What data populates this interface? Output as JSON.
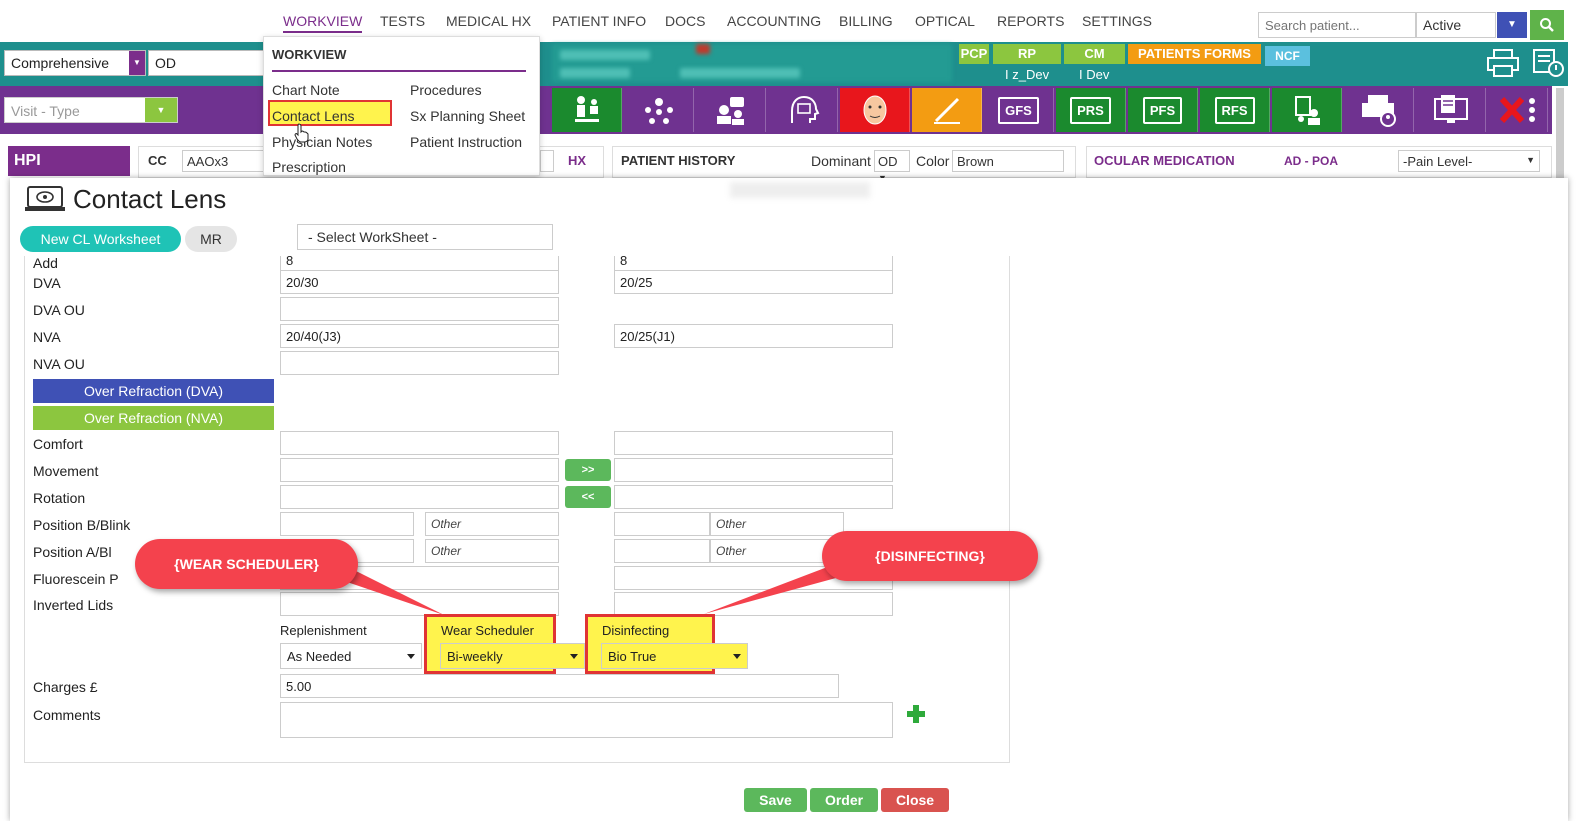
{
  "nav": {
    "items": [
      "WORKVIEW",
      "TESTS",
      "MEDICAL HX",
      "PATIENT INFO",
      "DOCS",
      "ACCOUNTING",
      "BILLING",
      "OPTICAL",
      "REPORTS",
      "SETTINGS"
    ],
    "search_placeholder": "Search patient...",
    "status": "Active"
  },
  "header": {
    "exam_type": "Comprehensive",
    "eye": "OD",
    "visit_type_placeholder": "Visit - Type",
    "tags": {
      "pcp": "PCP",
      "rp": "RP",
      "cm": "CM",
      "patients_forms": "PATIENTS FORMS",
      "ncf": "NCF"
    },
    "rp_value": "I z_Dev",
    "cm_value": "I Dev"
  },
  "toolbar": {
    "tools": [
      "GFS",
      "PRS",
      "PFS",
      "RFS"
    ]
  },
  "row": {
    "hpi": "HPI",
    "cc_label": "CC",
    "cc_value": "AAOx3",
    "hx_label": "HX",
    "patient_history": "PATIENT HISTORY",
    "dominant_label": "Dominant",
    "dominant_value": "OD",
    "color_label": "Color",
    "color_value": "Brown",
    "ocular_medication": "OCULAR MEDICATION",
    "ad_poa": "AD - POA",
    "pain_level": "-Pain Level-"
  },
  "menu": {
    "title": "WORKVIEW",
    "left": [
      "Chart Note",
      "Contact Lens",
      "Physician Notes",
      "Prescription"
    ],
    "right": [
      "Procedures",
      "Sx Planning Sheet",
      "Patient Instruction"
    ]
  },
  "modal": {
    "title": "Contact Lens",
    "new_ws": "New CL Worksheet",
    "mr": "MR",
    "select_ws": "- Select WorkSheet -",
    "labels": {
      "add": "Add",
      "dva": "DVA",
      "dva_ou": "DVA OU",
      "nva": "NVA",
      "nva_ou": "NVA OU",
      "comfort": "Comfort",
      "movement": "Movement",
      "rotation": "Rotation",
      "pos_b": "Position B/Blink",
      "pos_a": "Position A/Bl",
      "fluor": "Fluorescein P",
      "inverted": "Inverted Lids",
      "charges": "Charges £",
      "comments": "Comments"
    },
    "od": {
      "add": "8",
      "dva": "20/30",
      "nva": "20/40(J3)"
    },
    "os": {
      "add": "8",
      "dva": "20/25",
      "nva": "20/25(J1)"
    },
    "other": "Other",
    "over_dva": "Over Refraction (DVA)",
    "over_nva": "Over Refraction (NVA)",
    "copy_right": ">>",
    "copy_left": "<<",
    "replenishment_label": "Replenishment",
    "replenishment_value": "As Needed",
    "wear_label": "Wear Scheduler",
    "wear_value": "Bi-weekly",
    "disinfect_label": "Disinfecting",
    "disinfect_value": "Bio True",
    "charges_value": "5.00",
    "save": "Save",
    "order": "Order",
    "close": "Close"
  },
  "callouts": {
    "wear": "{WEAR SCHEDULER}",
    "disinfect": "{DISINFECTING}"
  },
  "colors": {
    "purple": "#6f3290",
    "teal": "#1e8f8d",
    "green": "#5cb85c",
    "red": "#d9534f",
    "highlight": "#fff34d",
    "callout": "#f4424d"
  }
}
